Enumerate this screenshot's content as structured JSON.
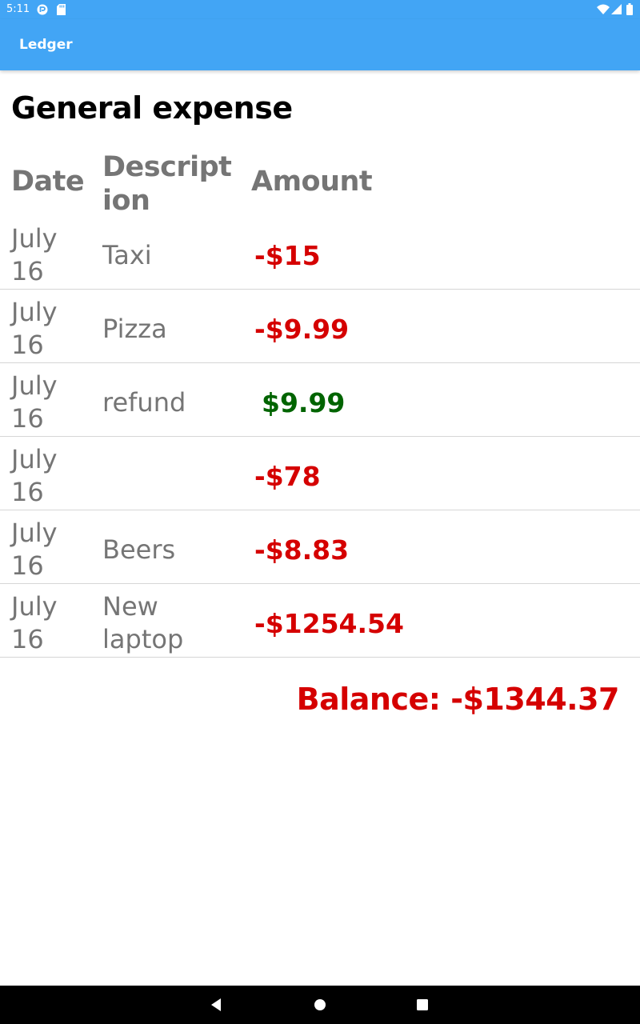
{
  "status_bar": {
    "time": "5:11",
    "icons": [
      "notification-icon",
      "sd-card-icon",
      "wifi-icon",
      "signal-icon",
      "battery-icon"
    ]
  },
  "app_bar": {
    "title": "Ledger",
    "color": "#42a5f5"
  },
  "page": {
    "title": "General expense"
  },
  "table": {
    "headers": {
      "date": "Date",
      "description": "Description",
      "amount": "Amount"
    },
    "rows": [
      {
        "date": "July 16",
        "description": "Taxi",
        "amount": "-$15",
        "color": "#d50000"
      },
      {
        "date": "July 16",
        "description": "Pizza",
        "amount": "-$9.99",
        "color": "#d50000"
      },
      {
        "date": "July 16",
        "description": "refund",
        "amount": "$9.99",
        "color": "#006400"
      },
      {
        "date": "July 16",
        "description": "",
        "amount": "-$78",
        "color": "#d50000"
      },
      {
        "date": "July 16",
        "description": "Beers",
        "amount": "-$8.83",
        "color": "#d50000"
      },
      {
        "date": "July 16",
        "description": "New laptop",
        "amount": "-$1254.54",
        "color": "#d50000"
      }
    ]
  },
  "balance": {
    "text": "Balance: -$1344.37",
    "color": "#d50000"
  },
  "nav_bar": {
    "buttons": [
      "back-icon",
      "home-icon",
      "recents-icon"
    ]
  }
}
